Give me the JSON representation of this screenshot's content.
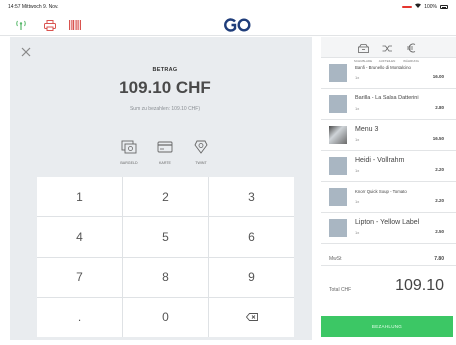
{
  "status_bar": {
    "time": "14:57",
    "date": "Mittwoch 9. Nov.",
    "battery_badge": "",
    "battery_text": "100%"
  },
  "top_bar": {
    "icons": [
      "antenna-icon",
      "printer-icon",
      "barcode-icon"
    ],
    "colors": {
      "antenna": "#58b86a",
      "printer": "#d9534f",
      "barcode": "#d9534f",
      "logo": "#1f3d7a"
    }
  },
  "payment": {
    "label": "BETRAG",
    "amount": "109.10 CHF",
    "sub": "Sum zu bezahlen: 109.10 CHF)",
    "methods": [
      {
        "icon": "banknote-icon",
        "label": "Bargeld"
      },
      {
        "icon": "card-icon",
        "label": "Karte"
      },
      {
        "icon": "twint-icon",
        "label": "Twint"
      }
    ]
  },
  "keypad": {
    "keys": [
      "1",
      "2",
      "3",
      "4",
      "5",
      "6",
      "7",
      "8",
      "9",
      ".",
      "0",
      "⌫"
    ]
  },
  "right_header": {
    "icons": [
      {
        "icon": "drawer-icon",
        "label": "Schublade"
      },
      {
        "icon": "split-icon",
        "label": "Aufteilen"
      },
      {
        "icon": "euro-icon",
        "label": "Währung"
      }
    ]
  },
  "cart": {
    "items": [
      {
        "name": "Banfi - Brunello di Montalcino",
        "qty": "1x",
        "price": "16.00",
        "size": "small",
        "thumb": "plain"
      },
      {
        "name": "Barilla - La Salsa Datterini",
        "qty": "1x",
        "price": "2.80",
        "size": "normal",
        "thumb": "plain"
      },
      {
        "name": "Menu 3",
        "qty": "1x",
        "price": "16.50",
        "size": "big",
        "thumb": "img"
      },
      {
        "name": "Heidi - Vollrahm",
        "qty": "1x",
        "price": "2.20",
        "size": "big",
        "thumb": "plain"
      },
      {
        "name": "Knorr Quick Soup - Tomato",
        "qty": "1x",
        "price": "2.20",
        "size": "small",
        "thumb": "plain"
      },
      {
        "name": "Lipton - Yellow Label",
        "qty": "1x",
        "price": "2.50",
        "size": "big",
        "thumb": "plain"
      }
    ]
  },
  "mwst": {
    "label": "MwSt",
    "value": "7.80"
  },
  "total": {
    "label": "Total CHF",
    "value": "109.10"
  },
  "pay_button": {
    "label": "Bezahlung"
  }
}
